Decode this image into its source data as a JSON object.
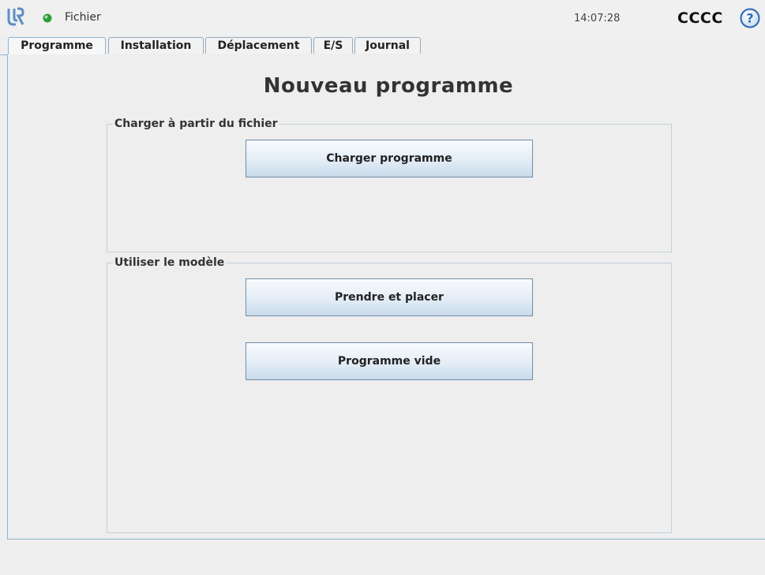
{
  "header": {
    "menu_label": "Fichier",
    "clock": "14:07:28",
    "robot_name": "CCCC",
    "help_glyph": "?",
    "status_color": "#2e9e3a",
    "logo_color": "#5b8ec7"
  },
  "tabs": [
    {
      "label": "Programme",
      "active": true
    },
    {
      "label": "Installation",
      "active": false
    },
    {
      "label": "Déplacement",
      "active": false
    },
    {
      "label": "E/S",
      "active": false
    },
    {
      "label": "Journal",
      "active": false
    }
  ],
  "main": {
    "title": "Nouveau programme",
    "load_group": {
      "legend": "Charger à partir du fichier",
      "load_button": "Charger programme"
    },
    "template_group": {
      "legend": "Utiliser le modèle",
      "pick_place_button": "Prendre et placer",
      "empty_program_button": "Programme vide"
    }
  }
}
